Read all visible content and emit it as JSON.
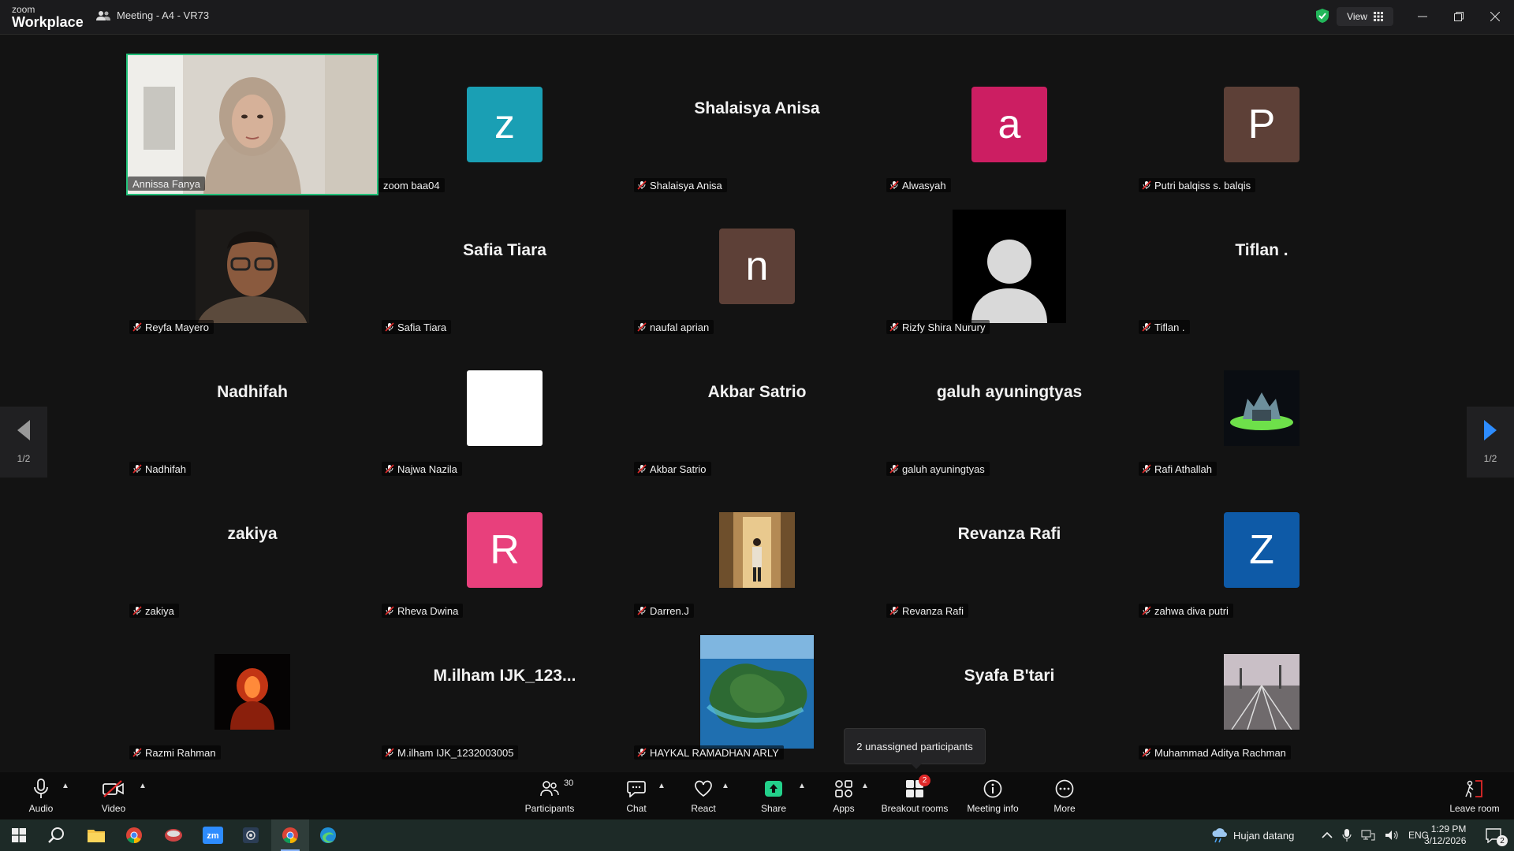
{
  "app": {
    "brand_line1": "zoom",
    "brand_line2": "Workplace",
    "meeting_title": "Meeting - A4 - VR73",
    "view_label": "View"
  },
  "colors": {
    "active_border": "#22c17a",
    "share_green": "#23d18b",
    "muted_red": "#e02828"
  },
  "tiles": [
    {
      "name": "Annissa Fanya",
      "display": "video",
      "active": true,
      "muted": false
    },
    {
      "name": "zoom baa04",
      "display": "letter",
      "letter": "z",
      "bg": "#1a9fb4",
      "muted": false
    },
    {
      "name": "Shalaisya Anisa",
      "display": "text",
      "big": "Shalaisya Anisa",
      "muted": true
    },
    {
      "name": "Alwasyah",
      "display": "letter",
      "letter": "a",
      "bg": "#cc1e62",
      "muted": true
    },
    {
      "name": "Putri balqiss s. balqis",
      "display": "letter",
      "letter": "P",
      "bg": "#5d4037",
      "muted": true
    },
    {
      "name": "Reyfa Mayero",
      "display": "photo",
      "photo": "portrait-glasses",
      "muted": true
    },
    {
      "name": "Safia Tiara",
      "display": "text",
      "big": "Safia Tiara",
      "muted": true
    },
    {
      "name": "naufal aprian",
      "display": "letter",
      "letter": "n",
      "bg": "#5d4037",
      "muted": true
    },
    {
      "name": "Rizfy Shira Nurury",
      "display": "photo",
      "photo": "default-user",
      "muted": true
    },
    {
      "name": "Tiflan .",
      "display": "text",
      "big": "Tiflan .",
      "muted": true
    },
    {
      "name": "Nadhifah",
      "display": "text",
      "big": "Nadhifah",
      "muted": true
    },
    {
      "name": "Najwa Nazila",
      "display": "photo",
      "photo": "blank-white",
      "muted": true
    },
    {
      "name": "Akbar Satrio",
      "display": "text",
      "big": "Akbar Satrio",
      "muted": true
    },
    {
      "name": "galuh ayuningtyas",
      "display": "text",
      "big": "galuh ayuningtyas",
      "muted": true
    },
    {
      "name": "Rafi Athallah",
      "display": "photo",
      "photo": "dark-art",
      "muted": true
    },
    {
      "name": "zakiya",
      "display": "text",
      "big": "zakiya",
      "muted": true
    },
    {
      "name": "Rheva Dwina",
      "display": "letter",
      "letter": "R",
      "bg": "#e8407c",
      "muted": true
    },
    {
      "name": "Darren.J",
      "display": "photo",
      "photo": "hallway",
      "muted": true
    },
    {
      "name": "Revanza Rafi",
      "display": "text",
      "big": "Revanza Rafi",
      "muted": true
    },
    {
      "name": "zahwa diva putri",
      "display": "letter",
      "letter": "Z",
      "bg": "#0e5aa7",
      "muted": true
    },
    {
      "name": "Razmi Rahman",
      "display": "photo",
      "photo": "red-figure",
      "muted": true
    },
    {
      "name": "M.ilham IJK_1232003005",
      "display": "text",
      "big": "M.ilham  IJK_123...",
      "muted": true
    },
    {
      "name": "HAYKAL RAMADHAN ARLY",
      "display": "photo",
      "photo": "island",
      "muted": true
    },
    {
      "name": "Syafa B'tari",
      "display": "text",
      "big": "Syafa B'tari",
      "muted": false
    },
    {
      "name": "Muhammad Aditya Rachman",
      "display": "photo",
      "photo": "railway",
      "muted": true
    }
  ],
  "pagination": {
    "left": "1/2",
    "right": "1/2"
  },
  "tooltip": "2 unassigned participants",
  "toolbar": {
    "audio": "Audio",
    "video": "Video",
    "participants": "Participants",
    "participants_count": "30",
    "chat": "Chat",
    "react": "React",
    "share": "Share",
    "apps": "Apps",
    "breakout": "Breakout rooms",
    "breakout_badge": "2",
    "meeting_info": "Meeting info",
    "more": "More",
    "leave": "Leave room"
  },
  "taskbar": {
    "weather": "Hujan datang",
    "lang": "ENG",
    "time": "1:29 PM",
    "date": "3/12/2026",
    "notif_count": "2"
  }
}
